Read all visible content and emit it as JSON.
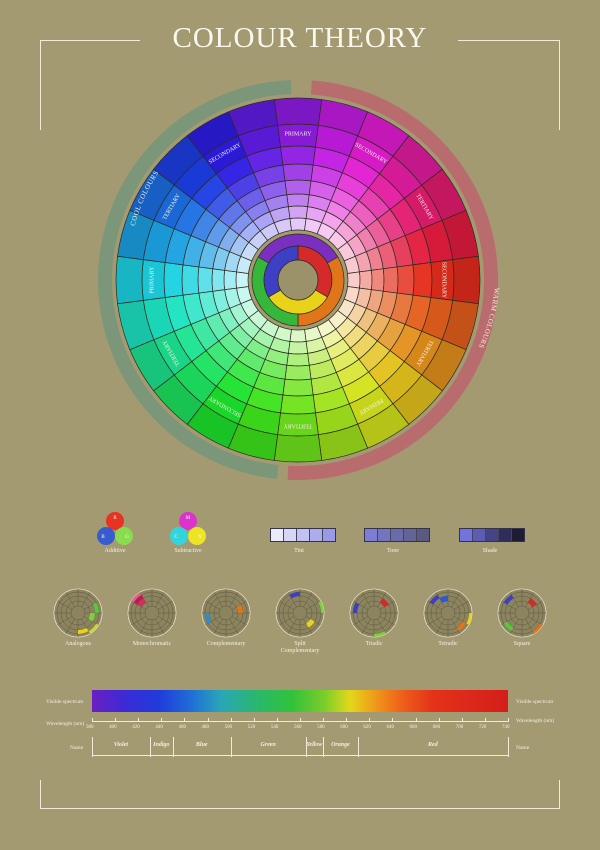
{
  "title": "COLOUR THEORY",
  "wheel": {
    "arc_cool": "COOL COLOURS",
    "arc_warm": "WARM COLOURS",
    "cool_arc_color": "#7b9678",
    "warm_arc_color": "#b86c6e",
    "rings": [
      "PRIMARY",
      "SECONDARY",
      "TERTIARY",
      "SECONDARY",
      "TERTIARY",
      "PRIMARY",
      "TERTIARY",
      "SECONDARY",
      "TERTIARY",
      "PRIMARY",
      "TERTIARY",
      "SECONDARY"
    ],
    "inner": {
      "primary": [
        "#d42a2a",
        "#e8d21a",
        "#3d3fc4"
      ],
      "secondary": [
        "#e0761a",
        "#36b63a",
        "#7a2fc0"
      ]
    }
  },
  "color_models": [
    {
      "label": "Additive",
      "circles": [
        {
          "letter": "R",
          "color": "#ee2a1c"
        },
        {
          "letter": "B",
          "color": "#2d57d6"
        },
        {
          "letter": "G",
          "color": "#86e24a"
        }
      ]
    },
    {
      "label": "Subtractive",
      "circles": [
        {
          "letter": "M",
          "color": "#e02ad2"
        },
        {
          "letter": "C",
          "color": "#2ad9e6"
        },
        {
          "letter": "Y",
          "color": "#f2ea1e"
        }
      ]
    }
  ],
  "scales": [
    {
      "label": "Tint",
      "colors": [
        "#ebebfa",
        "#d6d6f6",
        "#c2c2f2",
        "#adadee",
        "#9999ea"
      ]
    },
    {
      "label": "Tone",
      "colors": [
        "#7d7dd4",
        "#7474bf",
        "#6b6baa",
        "#636395",
        "#5a5a80"
      ]
    },
    {
      "label": "Shade",
      "colors": [
        "#7373e0",
        "#5c5cb3",
        "#454586",
        "#2e2e59",
        "#1c1c33"
      ]
    }
  ],
  "harmonies": [
    {
      "label": "Analogous",
      "highlight": [
        [
          2,
          "#57c940"
        ],
        [
          3,
          "#7bd03b"
        ],
        [
          4,
          "#c8d638"
        ],
        [
          5,
          "#e8d21a"
        ]
      ]
    },
    {
      "label": "Monochromatic",
      "highlight": [
        [
          10,
          "#b22050"
        ],
        [
          10,
          "#d2305c"
        ],
        [
          10,
          "#e2608a"
        ]
      ]
    },
    {
      "label": "Complementary",
      "highlight": [
        [
          8,
          "#2a8fd0"
        ],
        [
          2,
          "#e0761a"
        ]
      ]
    },
    {
      "label": "Split\nComplementary",
      "highlight": [
        [
          11,
          "#3d3fc4"
        ],
        [
          4,
          "#e8d21a"
        ],
        [
          2,
          "#7bd03b"
        ]
      ]
    },
    {
      "label": "Triadic",
      "highlight": [
        [
          9,
          "#3d3fc4"
        ],
        [
          1,
          "#d42a2a"
        ],
        [
          5,
          "#7bd03b"
        ]
      ]
    },
    {
      "label": "Tetradic",
      "highlight": [
        [
          10,
          "#3d3fc4"
        ],
        [
          11,
          "#2d57d6"
        ],
        [
          3,
          "#e8d21a"
        ],
        [
          4,
          "#e0761a"
        ]
      ]
    },
    {
      "label": "Square",
      "highlight": [
        [
          10,
          "#3d3fc4"
        ],
        [
          1,
          "#d42a2a"
        ],
        [
          4,
          "#e0761a"
        ],
        [
          7,
          "#57c940"
        ]
      ]
    }
  ],
  "spectrum": {
    "label_left": "Visible spectrum",
    "label_right": "Visible spectrum",
    "wavelength_left": "Wavelength (nm)",
    "wavelength_right": "Wavelength (nm)",
    "name_left": "Name",
    "name_right": "Name",
    "ticks": [
      "380",
      "400",
      "420",
      "440",
      "460",
      "480",
      "500",
      "520",
      "540",
      "560",
      "580",
      "600",
      "620",
      "640",
      "660",
      "680",
      "700",
      "720",
      "740"
    ],
    "bands": [
      {
        "name": "Violet",
        "start": 380,
        "end": 430
      },
      {
        "name": "Indigo",
        "start": 430,
        "end": 450
      },
      {
        "name": "Blue",
        "start": 450,
        "end": 500
      },
      {
        "name": "Green",
        "start": 500,
        "end": 565
      },
      {
        "name": "Yellow",
        "start": 565,
        "end": 580
      },
      {
        "name": "Orange",
        "start": 580,
        "end": 610
      },
      {
        "name": "Red",
        "start": 610,
        "end": 740
      }
    ]
  }
}
